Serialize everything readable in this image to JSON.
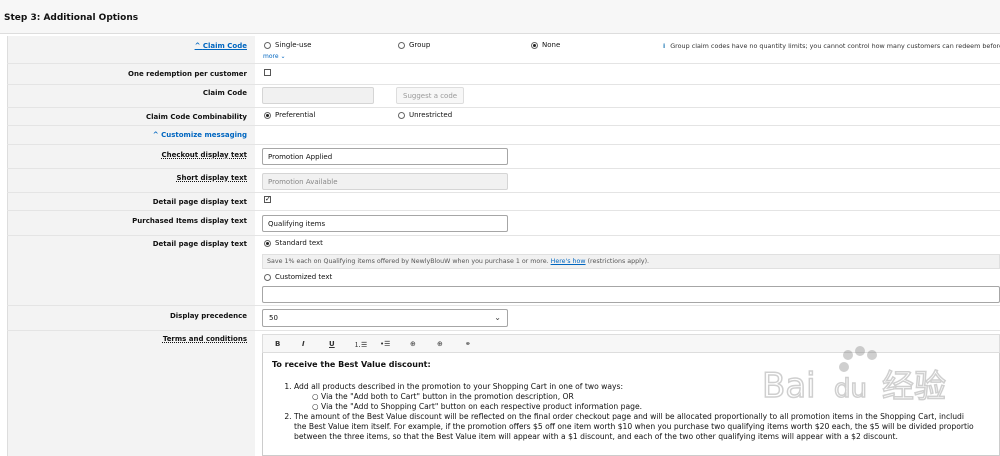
{
  "header": {
    "title": "Step 3: Additional Options"
  },
  "claim_type": {
    "label": "Claim Code",
    "options": [
      {
        "label": "Single-use",
        "selected": false
      },
      {
        "label": "Group",
        "selected": false
      },
      {
        "label": "None",
        "selected": true
      }
    ],
    "more_link": "more",
    "info": "Group claim codes have no quantity limits; you cannot control how many customers can redeem before promotio"
  },
  "one_redemption": {
    "label": "One redemption per customer",
    "checked": false
  },
  "claim_code": {
    "label": "Claim Code",
    "value": "",
    "suggest_button": "Suggest a code"
  },
  "combinability": {
    "label": "Claim Code Combinability",
    "options": [
      {
        "label": "Preferential",
        "selected": true
      },
      {
        "label": "Unrestricted",
        "selected": false
      }
    ]
  },
  "customize_messaging": {
    "label": "Customize messaging"
  },
  "checkout_display": {
    "label": "Checkout display text",
    "value": "Promotion Applied"
  },
  "short_display": {
    "label": "Short display text",
    "value": "Promotion Available"
  },
  "detail_page_checkbox": {
    "label": "Detail page display text",
    "checked": true
  },
  "purchased_items": {
    "label": "Purchased Items display text",
    "value": "Qualifying items"
  },
  "detail_page_text": {
    "label": "Detail page display text",
    "standard_label": "Standard text",
    "standard_selected": true,
    "preview_text": "Save 1% each on Qualifying items offered by NewlyBlouW when you purchase 1 or more.",
    "preview_link": "Here's how",
    "preview_suffix": "(restrictions apply).",
    "customized_label": "Customized text",
    "customized_value": ""
  },
  "display_precedence": {
    "label": "Display precedence",
    "value": "50"
  },
  "terms": {
    "label": "Terms and conditions",
    "toolbar": [
      "B",
      "I",
      "U",
      "ordered-list",
      "bullet-list",
      "indent",
      "outdent",
      "link"
    ],
    "heading": "To receive the Best Value discount:",
    "items": [
      {
        "text": "Add all products described in the promotion to your Shopping Cart in one of two ways:",
        "sub": [
          "Via the \"Add both to Cart\" button in the promotion description, OR",
          "Via the \"Add to Shopping Cart\" button on each respective product information page."
        ]
      },
      {
        "text": "The amount of the Best Value discount will be reflected on the final order checkout page and will be allocated proportionally to all promotion items in the Shopping Cart, includi",
        "cont": [
          "the Best Value item itself. For example, if the promotion offers $5 off one item worth $10 when you purchase two qualifying items worth $20 each, the $5 will be divided proportio",
          "between the three items, so that the Best Value item will appear with a $1 discount, and each of the two other qualifying items will appear with a $2 discount."
        ]
      }
    ]
  },
  "watermark": {
    "text": "Bai du 经验"
  },
  "colors": {
    "link": "#0066c0",
    "label_bg": "#f3f3f3",
    "info_icon": "#2a7fb8"
  }
}
